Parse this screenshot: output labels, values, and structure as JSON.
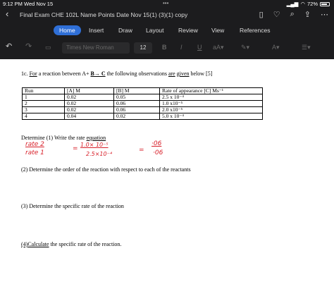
{
  "status": {
    "time": "9:12 PM  Wed Nov 15",
    "battery": "72%"
  },
  "title": {
    "text": "Final Exam CHE 102L  Name  Points  Date  Nov 15(1) (3)(1) copy"
  },
  "tabs": [
    {
      "label": "Home"
    },
    {
      "label": "Insert"
    },
    {
      "label": "Draw"
    },
    {
      "label": "Layout"
    },
    {
      "label": "Review"
    },
    {
      "label": "View"
    },
    {
      "label": "References"
    }
  ],
  "toolbar": {
    "font": "Times New Roman",
    "size": "12",
    "bold": "B",
    "italic": "I",
    "underline": "U"
  },
  "doc": {
    "q1c_prefix": "1c. ",
    "q1c_for": "For",
    "q1c_mid": " a reaction between A+ ",
    "q1c_arrow": "B→ C",
    "q1c_mid2": " the following observations ",
    "q1c_are": "are",
    "q1c_sp": " ",
    "q1c_given": "given",
    "q1c_end": " below [5]",
    "table": {
      "headers": [
        "Run",
        "[A] M",
        "[B] M",
        "Rate of appearance [C] Ms⁻¹"
      ],
      "rows": [
        [
          "1",
          "0.02",
          "0.05",
          "2.5 x 10⁻⁴"
        ],
        [
          "2",
          "0.02",
          "0.06",
          "1.0 x10⁻⁵"
        ],
        [
          "3",
          "0.02",
          "0.06",
          "2.0 x10⁻⁵"
        ],
        [
          "4",
          "0.04",
          "0.02",
          "5.0 x 10⁻⁴"
        ]
      ]
    },
    "q1_a": "Determine (1) Write the rate ",
    "q1_b": "equation",
    "q2": "(2) Determine the order of the reaction with respect to each of the reactants",
    "q3": "(3) Determine the specific rate of the reaction",
    "q4_a": "(4)",
    "q4_b": "Calculate",
    "q4_c": " the specific rate of the reaction."
  },
  "handwriting": {
    "rate2": "rate 2",
    "rate1": "rate 1",
    "eq": "=",
    "num": "1.0× 10⁻⁵",
    "den": "2.5×10⁻⁴",
    "eq2": "=",
    "num2": "·06",
    "den2": "·06"
  },
  "colors": {
    "accent": "#2f6fd7",
    "ink": "#d8202a"
  }
}
